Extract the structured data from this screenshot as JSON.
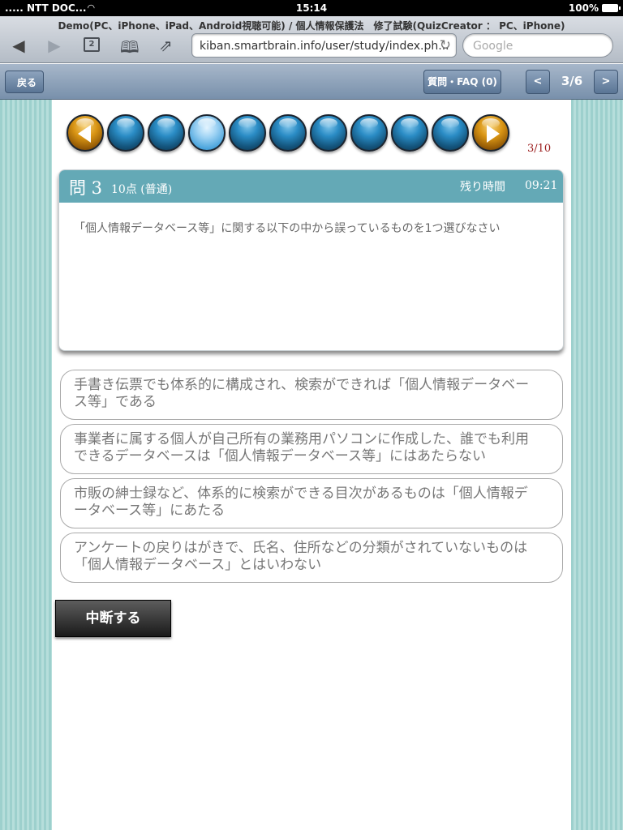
{
  "status_bar": {
    "carrier": "..... NTT DOC...",
    "time": "15:14",
    "battery": "100%"
  },
  "browser": {
    "page_title": "Demo(PC、iPhone、iPad、Android視聴可能) / 個人情報保護法　修了試験(QuizCreator ： PC、iPhone)",
    "tab_count": "2",
    "url": "kiban.smartbrain.info/user/study/index.ph...",
    "search_placeholder": "Google"
  },
  "app_toolbar": {
    "back_label": "戻る",
    "faq_label": "質問・FAQ (0)",
    "prev_label": "<",
    "next_label": ">",
    "page_indicator": "3/6"
  },
  "progress": {
    "total_questions": 10,
    "current_question": 3,
    "count_label": "3/10"
  },
  "question": {
    "number_label": "問 3",
    "points_label": "10点 (普通)",
    "remaining_label": "残り時間",
    "remaining_time": "09:21",
    "text": "「個人情報データベース等」に関する以下の中から誤っているものを1つ選びなさい"
  },
  "choices": [
    "手書き伝票でも体系的に構成され、検索ができれば「個人情報データベース等」である",
    "事業者に属する個人が自己所有の業務用パソコンに作成した、誰でも利用できるデータベースは「個人情報データベース等」にはあたらない",
    "市販の紳士録など、体系的に検索ができる目次があるものは「個人情報データベース等」にあたる",
    "アンケートの戻りはがきで、氏名、住所などの分類がされていないものは「個人情報データベース」とはいわない"
  ],
  "actions": {
    "suspend_label": "中断する"
  },
  "colors": {
    "header_teal": "#64a9b6",
    "side_stripe": "#9dd0cd",
    "toolbar_blue": "#7890ab",
    "count_red": "#9b1c1c"
  }
}
